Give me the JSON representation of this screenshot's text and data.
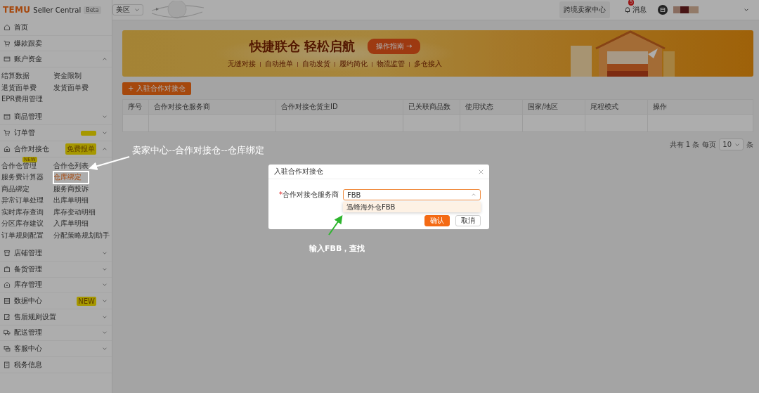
{
  "top_bar": {
    "logo": "TEMU",
    "product": "Seller Central",
    "tag": "Beta",
    "region": "美区",
    "seller_center": "跨境卖家中心",
    "messages": {
      "label": "消息",
      "count": "5"
    }
  },
  "sidebar": {
    "items": [
      {
        "kind": "link",
        "label": "首页",
        "tagged": false
      },
      {
        "kind": "link",
        "label": "爆款跟卖",
        "tagged": false
      },
      {
        "kind": "group",
        "label": "账户资金",
        "expanded": true,
        "tagged": false,
        "children": [
          {
            "label": "结算数据",
            "selected": false
          },
          {
            "label": "资金限制",
            "selected": false
          },
          {
            "label": "退货面单费",
            "selected": false
          },
          {
            "label": "发货面单费",
            "selected": false
          },
          {
            "label": "EPR费用管理",
            "selected": false
          }
        ]
      },
      {
        "kind": "group",
        "label": "商品管理",
        "expanded": false,
        "tagged": false
      },
      {
        "kind": "group",
        "label": "订单管",
        "expanded": false,
        "tagged": true
      },
      {
        "kind": "group",
        "label": "合作对接仓",
        "expanded": true,
        "tagged": false,
        "badge": "免费报单",
        "children": [
          {
            "label": "合作仓管理",
            "selected": false,
            "badge": "NEW"
          },
          {
            "label": "合作仓列表",
            "selected": false
          },
          {
            "label": "服务费计算器",
            "selected": false
          },
          {
            "label": "仓库绑定",
            "selected": true
          },
          {
            "label": "商品绑定",
            "selected": false
          },
          {
            "label": "服务商投诉",
            "selected": false
          },
          {
            "label": "异常订单处理",
            "selected": false
          },
          {
            "label": "出库单明细",
            "selected": false
          },
          {
            "label": "实时库存查询",
            "selected": false
          },
          {
            "label": "库存变动明细",
            "selected": false
          },
          {
            "label": "分区库存建议",
            "selected": false
          },
          {
            "label": "入库单明细",
            "selected": false
          },
          {
            "label": "订单规则配置",
            "selected": false
          },
          {
            "label": "分配策略规划助手",
            "selected": false
          }
        ]
      },
      {
        "kind": "group",
        "label": "店铺管理",
        "expanded": false,
        "tagged": false
      },
      {
        "kind": "group",
        "label": "备货管理",
        "expanded": false,
        "tagged": false
      },
      {
        "kind": "group",
        "label": "库存管理",
        "expanded": false,
        "tagged": false
      },
      {
        "kind": "group",
        "label": "数据中心",
        "expanded": false,
        "tagged": false,
        "badge": "NEW"
      },
      {
        "kind": "group",
        "label": "售后规则设置",
        "expanded": false,
        "tagged": false
      },
      {
        "kind": "group",
        "label": "配送管理",
        "expanded": false,
        "tagged": false
      },
      {
        "kind": "group",
        "label": "客服中心",
        "expanded": false,
        "tagged": false
      },
      {
        "kind": "link",
        "label": "税务信息",
        "tagged": false
      }
    ]
  },
  "banner": {
    "title": "快捷联仓 轻松启航",
    "button": "操作指南 →",
    "features": [
      "无缝对接",
      "自动推单",
      "自动发货",
      "履约简化",
      "物流监管",
      "多仓接入"
    ]
  },
  "add_button": "+ 入驻合作对接仓",
  "table": {
    "columns": [
      "序号",
      "合作对接仓服务商",
      "合作对接仓货主ID",
      "已关联商品数",
      "使用状态",
      "国家/地区",
      "尾程模式",
      "操作"
    ]
  },
  "pagination": {
    "total": "共有 1 条",
    "per_page_label": "每页",
    "per_page": "10",
    "unit": "条"
  },
  "dialog": {
    "title": "入驻合作对接仓",
    "field": {
      "required_mark": "*",
      "label": "合作对接仓服务商",
      "value": "FBB"
    },
    "options": [
      {
        "label": "迅蜂海外仓FBB",
        "highlighted": true
      }
    ],
    "buttons": [
      {
        "label": "确认",
        "kind": "primary"
      },
      {
        "label": "取消",
        "kind": "default"
      }
    ]
  },
  "annotations": [
    {
      "kind": "path_note",
      "text": "卖家中心--合作对接仓--仓库绑定"
    },
    {
      "kind": "search_note",
      "text": "输入FBB，查找"
    }
  ]
}
